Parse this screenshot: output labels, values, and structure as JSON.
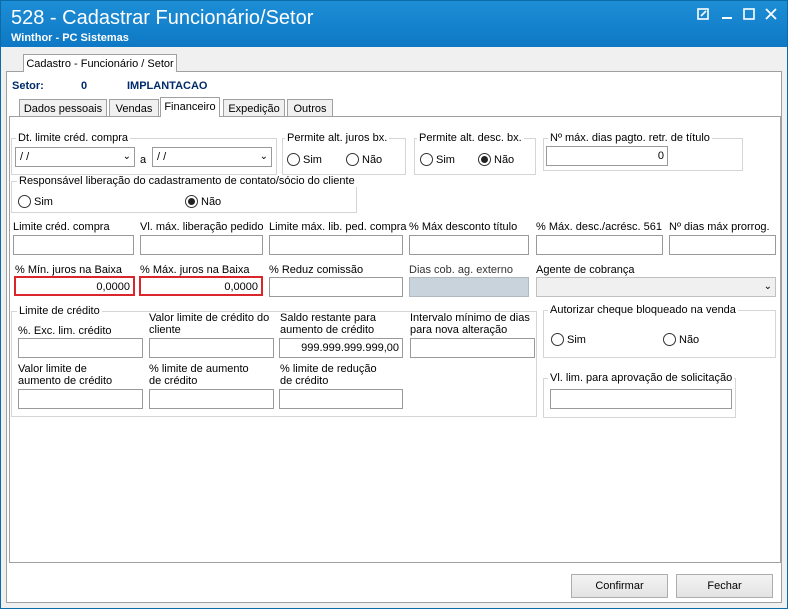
{
  "window": {
    "title": "528 - Cadastrar Funcionário/Setor",
    "subtitle": "Winthor - PC Sistemas",
    "controls": [
      "restore-icon",
      "minimize-icon",
      "maximize-icon",
      "close-icon"
    ]
  },
  "top_tab": "Cadastro - Funcionário / Setor",
  "setor": {
    "label": "Setor:",
    "code": "0",
    "name": "IMPLANTACAO"
  },
  "tabs": [
    "Dados pessoais",
    "Vendas",
    "Financeiro",
    "Expedição",
    "Outros"
  ],
  "active_tab": "Financeiro",
  "credit_date": {
    "label": "Dt. limite créd. compra",
    "from": "/ /",
    "separator": "a",
    "to": "/ /"
  },
  "allow_interest": {
    "label": "Permite alt. juros bx.",
    "options": [
      "Sim",
      "Não"
    ],
    "selected": ""
  },
  "allow_discount": {
    "label": "Permite alt. desc. bx.",
    "options": [
      "Sim",
      "Não"
    ],
    "selected": "Não"
  },
  "max_days": {
    "label": "Nº máx. dias pagto. retr. de título",
    "value": "0"
  },
  "responsible": {
    "label": "Responsável liberação do cadastramento de contato/sócio do cliente",
    "options": [
      "Sim",
      "Não"
    ],
    "selected": "Não"
  },
  "row1": {
    "limite_cred": {
      "label": "Limite créd. compra",
      "value": ""
    },
    "vl_max": {
      "label": "Vl. máx. liberação pedido",
      "value": ""
    },
    "limite_lib": {
      "label": "Limite máx. lib. ped. compra",
      "value": ""
    },
    "max_desconto": {
      "label": "% Máx desconto título",
      "value": ""
    },
    "max_desc_acresc": {
      "label": "% Máx. desc./acrésc. 561",
      "value": ""
    },
    "dias_prorrog": {
      "label": "Nº dias máx prorrog.",
      "value": ""
    }
  },
  "row2": {
    "min_juros": {
      "label": "% Mín. juros na Baixa",
      "value": "0,0000"
    },
    "max_juros": {
      "label": "% Máx. juros na Baixa",
      "value": "0,0000"
    },
    "reduz_comissao": {
      "label": "% Reduz  comissão",
      "value": ""
    },
    "dias_cob": {
      "label": "Dias cob. ag. externo",
      "value": ""
    },
    "agente": {
      "label": "Agente de cobrança",
      "value": ""
    }
  },
  "credit_limit": {
    "label": "Limite de crédito",
    "exc_lim": {
      "label": "%. Exc. lim. crédito",
      "value": ""
    },
    "valor_limite": {
      "label": "Valor limite de crédito do cliente",
      "value": ""
    },
    "saldo": {
      "label": "Saldo restante para aumento de crédito",
      "value": "999.999.999.999,00"
    },
    "intervalo": {
      "label": "Intervalo mínimo de dias para nova alteração",
      "value": ""
    },
    "valor_aumento": {
      "label": "Valor limite de aumento de crédito",
      "value": ""
    },
    "pct_aumento": {
      "label": "% limite de aumento de crédito",
      "value": ""
    },
    "pct_reducao": {
      "label": "% limite de redução de crédito",
      "value": ""
    }
  },
  "cheque": {
    "label": "Autorizar cheque bloqueado na venda",
    "options": [
      "Sim",
      "Não"
    ],
    "selected": ""
  },
  "vl_lim_aprov": {
    "label": "Vl. lim. para aprovação de solicitação",
    "value": ""
  },
  "buttons": {
    "confirm": "Confirmar",
    "close": "Fechar"
  }
}
